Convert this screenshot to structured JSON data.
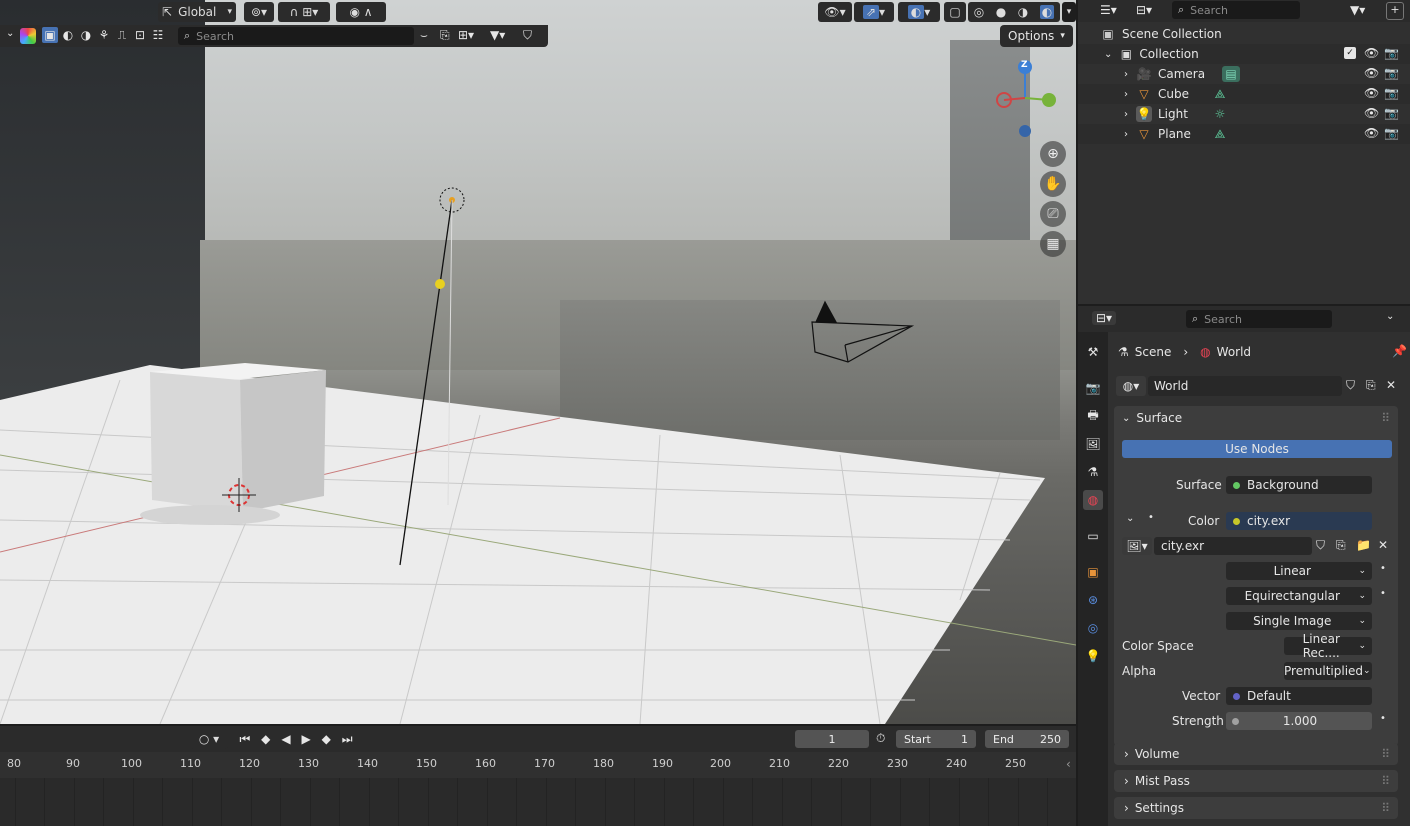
{
  "viewport": {
    "toolbar": {
      "orientation": "Global",
      "options_label": "Options"
    },
    "search_placeholder": "Search",
    "gizmo": {
      "z": "Z"
    }
  },
  "timeline": {
    "current_frame": "1",
    "start_label": "Start",
    "start_value": "1",
    "end_label": "End",
    "end_value": "250",
    "ruler": [
      "80",
      "90",
      "100",
      "110",
      "120",
      "130",
      "140",
      "150",
      "160",
      "170",
      "180",
      "190",
      "200",
      "210",
      "220",
      "230",
      "240",
      "250"
    ]
  },
  "outliner": {
    "search_placeholder": "Search",
    "root": "Scene Collection",
    "collection": "Collection",
    "items": [
      {
        "label": "Camera",
        "icon": "camera-icon"
      },
      {
        "label": "Cube",
        "icon": "mesh-icon"
      },
      {
        "label": "Light",
        "icon": "light-icon"
      },
      {
        "label": "Plane",
        "icon": "mesh-icon"
      }
    ]
  },
  "properties": {
    "search_placeholder": "Search",
    "breadcrumb": {
      "scene": "Scene",
      "world": "World"
    },
    "world_name": "World",
    "surface": {
      "title": "Surface",
      "use_nodes": "Use Nodes",
      "surface_label": "Surface",
      "surface_value": "Background",
      "color_label": "Color",
      "color_value": "city.exr",
      "image_name": "city.exr",
      "interpolation": "Linear",
      "projection": "Equirectangular",
      "source": "Single Image",
      "color_space_label": "Color Space",
      "color_space_value": "Linear Rec....",
      "alpha_label": "Alpha",
      "alpha_value": "Premultiplied",
      "vector_label": "Vector",
      "vector_value": "Default",
      "strength_label": "Strength",
      "strength_value": "1.000"
    },
    "volume": "Volume",
    "mist_pass": "Mist Pass",
    "settings": "Settings"
  },
  "colors": {
    "accent": "#4772b3",
    "background_node": "#63c763",
    "color_socket": "#c7c729",
    "vector_socket": "#6363c7",
    "strength_socket": "#a1a1a1"
  }
}
